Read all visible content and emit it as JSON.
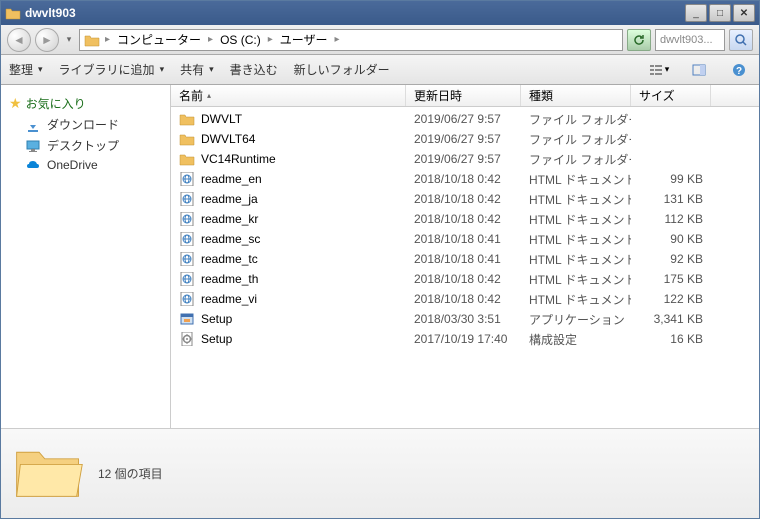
{
  "window": {
    "title": "dwvlt903"
  },
  "address": {
    "parts": [
      "コンピューター",
      "OS (C:)",
      "ユーザー"
    ],
    "search_placeholder": "dwvlt903..."
  },
  "toolbar": {
    "organize": "整理",
    "add_to_library": "ライブラリに追加",
    "share": "共有",
    "burn": "書き込む",
    "new_folder": "新しいフォルダー"
  },
  "sidebar": {
    "favorites_label": "お気に入り",
    "items": [
      {
        "label": "ダウンロード",
        "icon": "download"
      },
      {
        "label": "デスクトップ",
        "icon": "desktop"
      },
      {
        "label": "OneDrive",
        "icon": "onedrive"
      }
    ]
  },
  "columns": {
    "name": "名前",
    "date": "更新日時",
    "type": "種類",
    "size": "サイズ"
  },
  "files": [
    {
      "name": "DWVLT",
      "date": "2019/06/27 9:57",
      "type": "ファイル フォルダー",
      "size": "",
      "icon": "folder"
    },
    {
      "name": "DWVLT64",
      "date": "2019/06/27 9:57",
      "type": "ファイル フォルダー",
      "size": "",
      "icon": "folder"
    },
    {
      "name": "VC14Runtime",
      "date": "2019/06/27 9:57",
      "type": "ファイル フォルダー",
      "size": "",
      "icon": "folder"
    },
    {
      "name": "readme_en",
      "date": "2018/10/18 0:42",
      "type": "HTML ドキュメント",
      "size": "99 KB",
      "icon": "html"
    },
    {
      "name": "readme_ja",
      "date": "2018/10/18 0:42",
      "type": "HTML ドキュメント",
      "size": "131 KB",
      "icon": "html"
    },
    {
      "name": "readme_kr",
      "date": "2018/10/18 0:42",
      "type": "HTML ドキュメント",
      "size": "112 KB",
      "icon": "html"
    },
    {
      "name": "readme_sc",
      "date": "2018/10/18 0:41",
      "type": "HTML ドキュメント",
      "size": "90 KB",
      "icon": "html"
    },
    {
      "name": "readme_tc",
      "date": "2018/10/18 0:41",
      "type": "HTML ドキュメント",
      "size": "92 KB",
      "icon": "html"
    },
    {
      "name": "readme_th",
      "date": "2018/10/18 0:42",
      "type": "HTML ドキュメント",
      "size": "175 KB",
      "icon": "html"
    },
    {
      "name": "readme_vi",
      "date": "2018/10/18 0:42",
      "type": "HTML ドキュメント",
      "size": "122 KB",
      "icon": "html"
    },
    {
      "name": "Setup",
      "date": "2018/03/30 3:51",
      "type": "アプリケーション",
      "size": "3,341 KB",
      "icon": "exe"
    },
    {
      "name": "Setup",
      "date": "2017/10/19 17:40",
      "type": "構成設定",
      "size": "16 KB",
      "icon": "ini"
    }
  ],
  "status": {
    "count_text": "12 個の項目"
  }
}
